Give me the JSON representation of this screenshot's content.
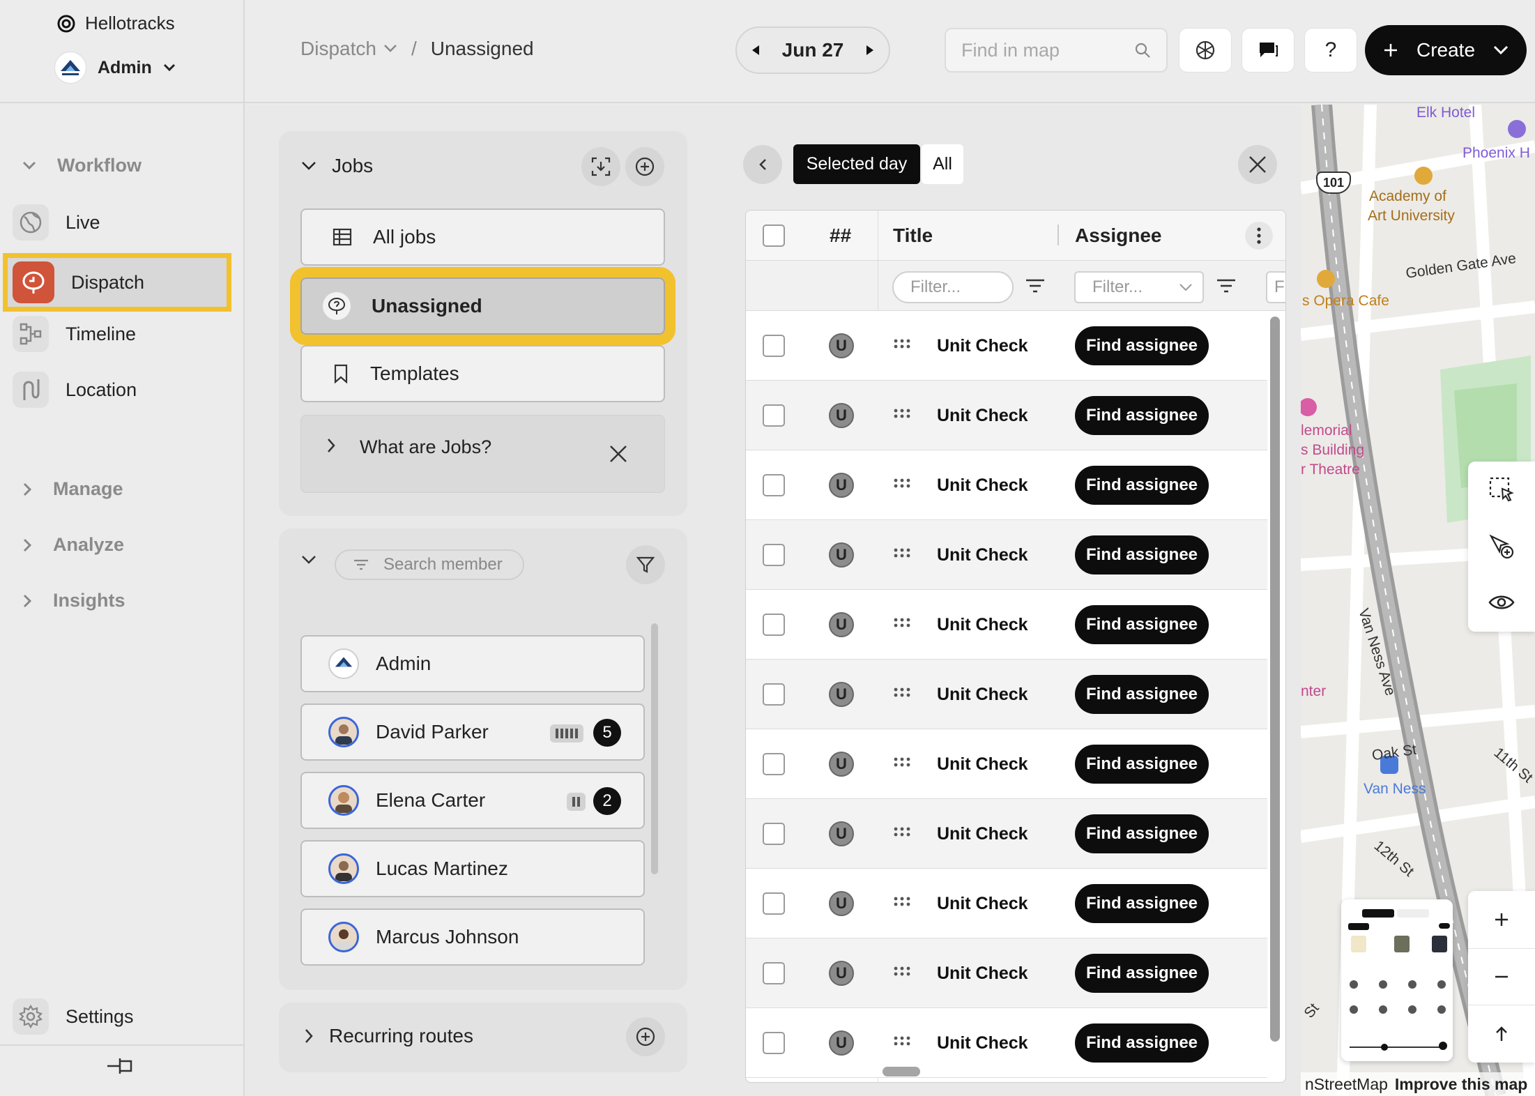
{
  "app": {
    "name": "Hellotracks"
  },
  "account": {
    "name": "Admin"
  },
  "sidebar": {
    "workflow_label": "Workflow",
    "items": [
      {
        "label": "Live"
      },
      {
        "label": "Dispatch"
      },
      {
        "label": "Timeline"
      },
      {
        "label": "Location"
      }
    ],
    "manage_label": "Manage",
    "analyze_label": "Analyze",
    "insights_label": "Insights",
    "settings_label": "Settings"
  },
  "header": {
    "breadcrumb_root": "Dispatch",
    "breadcrumb_separator": "/",
    "breadcrumb_current": "Unassigned",
    "date": "Jun 27",
    "search_placeholder": "Find in map",
    "help_label": "?",
    "create_label": "Create"
  },
  "jobs_panel": {
    "title": "Jobs",
    "items": [
      {
        "label": "All jobs"
      },
      {
        "label": "Unassigned"
      },
      {
        "label": "Templates"
      }
    ],
    "hint_label": "What are Jobs?"
  },
  "members_panel": {
    "search_placeholder": "Search member",
    "members": [
      {
        "name": "Admin"
      },
      {
        "name": "David Parker",
        "count": "5"
      },
      {
        "name": "Elena Carter",
        "count": "2"
      },
      {
        "name": "Lucas Martinez"
      },
      {
        "name": "Marcus Johnson"
      }
    ]
  },
  "routes_panel": {
    "title": "Recurring routes"
  },
  "table": {
    "toggle": {
      "selected_day": "Selected day",
      "all": "All"
    },
    "columns": {
      "number": "##",
      "title": "Title",
      "assignee": "Assignee"
    },
    "filter_placeholder": "Filter...",
    "rows": [
      {
        "badge": "U",
        "title": "Unit Check",
        "action": "Find assignee"
      },
      {
        "badge": "U",
        "title": "Unit Check",
        "action": "Find assignee"
      },
      {
        "badge": "U",
        "title": "Unit Check",
        "action": "Find assignee"
      },
      {
        "badge": "U",
        "title": "Unit Check",
        "action": "Find assignee"
      },
      {
        "badge": "U",
        "title": "Unit Check",
        "action": "Find assignee"
      },
      {
        "badge": "U",
        "title": "Unit Check",
        "action": "Find assignee"
      },
      {
        "badge": "U",
        "title": "Unit Check",
        "action": "Find assignee"
      },
      {
        "badge": "U",
        "title": "Unit Check",
        "action": "Find assignee"
      },
      {
        "badge": "U",
        "title": "Unit Check",
        "action": "Find assignee"
      },
      {
        "badge": "U",
        "title": "Unit Check",
        "action": "Find assignee"
      },
      {
        "badge": "U",
        "title": "Unit Check",
        "action": "Find assignee"
      }
    ]
  },
  "map": {
    "labels": {
      "elk_hotel": "Elk Hotel",
      "phoenix": "Phoenix H",
      "academy": "Academy of",
      "art_university": "Art University",
      "golden_gate": "Golden Gate Ave",
      "opera_cafe": "s Opera Cafe",
      "memorial": "lemorial",
      "building": "s Building",
      "theatre": "r Theatre",
      "van_ness_ave": "Van Ness Ave",
      "nter": "nter",
      "oak_st": "Oak St",
      "van_ness": "Van Ness",
      "eleventh": "11th St",
      "twelfth": "12th St",
      "st": "St",
      "highway": "101"
    },
    "attribution": "nStreetMap",
    "improve_link": "Improve this map"
  }
}
